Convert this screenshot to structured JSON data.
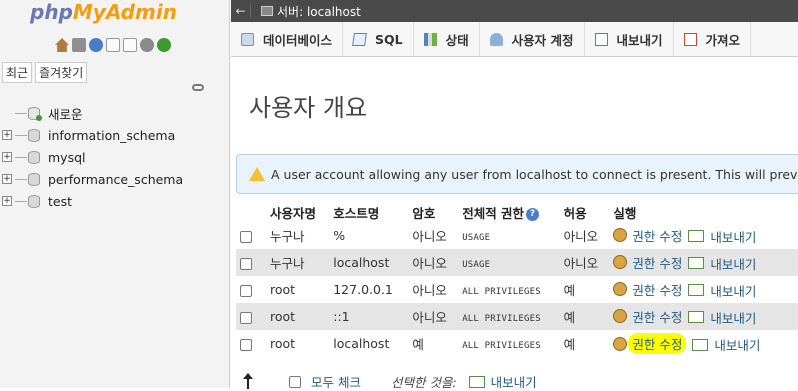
{
  "nav": {
    "logo_part1": "php",
    "logo_part2": "MyAdmin",
    "tabs": [
      "최근",
      "즐겨찾기"
    ],
    "tree": [
      {
        "label": "새로운",
        "kind": "new"
      },
      {
        "label": "information_schema",
        "kind": "db"
      },
      {
        "label": "mysql",
        "kind": "db"
      },
      {
        "label": "performance_schema",
        "kind": "db"
      },
      {
        "label": "test",
        "kind": "db"
      }
    ]
  },
  "server_bar": {
    "back": "←",
    "label": "서버: localhost"
  },
  "menu": {
    "tabs": [
      {
        "label": "데이터베이스",
        "icon": "database-icon"
      },
      {
        "label": "SQL",
        "icon": "sql-icon"
      },
      {
        "label": "상태",
        "icon": "status-icon"
      },
      {
        "label": "사용자 계정",
        "icon": "users-icon"
      },
      {
        "label": "내보내기",
        "icon": "export-icon"
      },
      {
        "label": "가져오",
        "icon": "import-icon"
      }
    ]
  },
  "page": {
    "title": "사용자 개요",
    "notice": "A user account allowing any user from localhost to connect is present. This will prevent"
  },
  "table": {
    "headers": [
      "사용자명",
      "호스트명",
      "암호",
      "전체적 권한",
      "허용",
      "실행"
    ],
    "rows": [
      {
        "user": "누구나",
        "host": "%",
        "password": "아니오",
        "privileges": "USAGE",
        "grant": "아니오"
      },
      {
        "user": "누구나",
        "host": "localhost",
        "password": "아니오",
        "privileges": "USAGE",
        "grant": "아니오"
      },
      {
        "user": "root",
        "host": "127.0.0.1",
        "password": "아니오",
        "privileges": "ALL PRIVILEGES",
        "grant": "예"
      },
      {
        "user": "root",
        "host": "::1",
        "password": "아니오",
        "privileges": "ALL PRIVILEGES",
        "grant": "예"
      },
      {
        "user": "root",
        "host": "localhost",
        "password": "예",
        "privileges": "ALL PRIVILEGES",
        "grant": "예"
      }
    ],
    "action_edit": "권한 수정",
    "action_export": "내보내기"
  },
  "footer": {
    "select_all": "모두 체크",
    "with_selected": "선택한 것을:",
    "export": "내보내기"
  },
  "colors": {
    "accent_red": "#cc0000",
    "link": "#235a81",
    "highlight": "#ffff00"
  }
}
